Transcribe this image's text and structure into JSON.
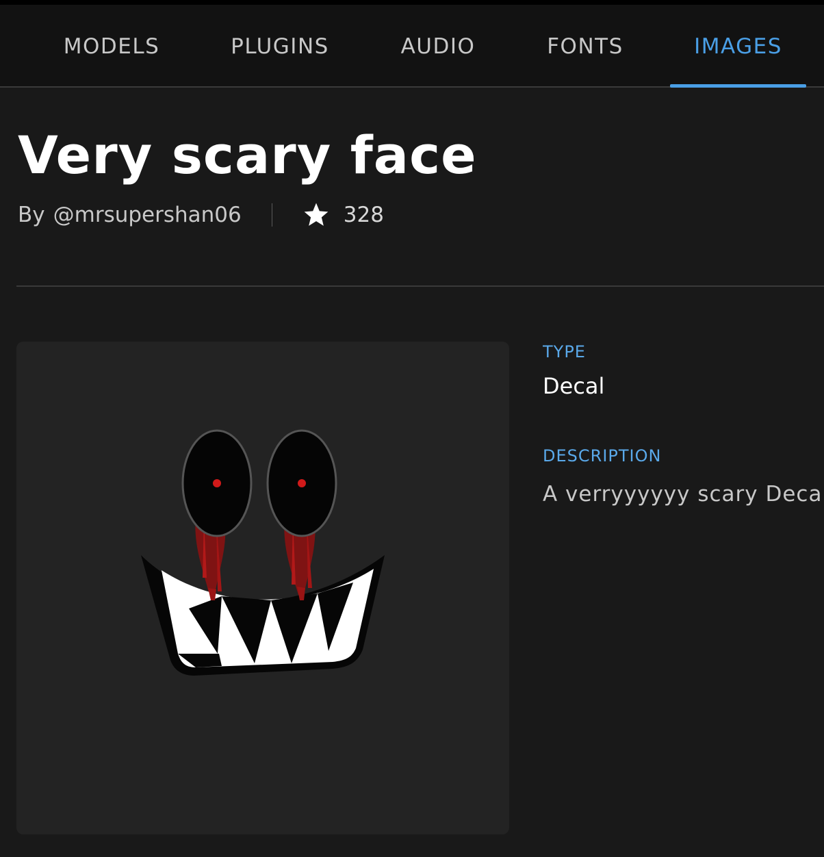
{
  "nav": {
    "tabs": [
      {
        "label": "MODELS",
        "active": false
      },
      {
        "label": "PLUGINS",
        "active": false
      },
      {
        "label": "AUDIO",
        "active": false
      },
      {
        "label": "FONTS",
        "active": false
      },
      {
        "label": "IMAGES",
        "active": true
      }
    ]
  },
  "asset": {
    "title": "Very scary face",
    "by_prefix": "By",
    "creator": "@mrsupershan06",
    "rating": "328",
    "rating_icon": "star-icon",
    "preview_icon": "scary-face-decal-image"
  },
  "details": {
    "type_label": "TYPE",
    "type_value": "Decal",
    "description_label": "DESCRIPTION",
    "description_value": "A verryyyyyy scary Deca"
  },
  "colors": {
    "accent": "#4a9fe6",
    "background": "#191919",
    "nav_background": "#121212",
    "preview_background": "#232323"
  }
}
